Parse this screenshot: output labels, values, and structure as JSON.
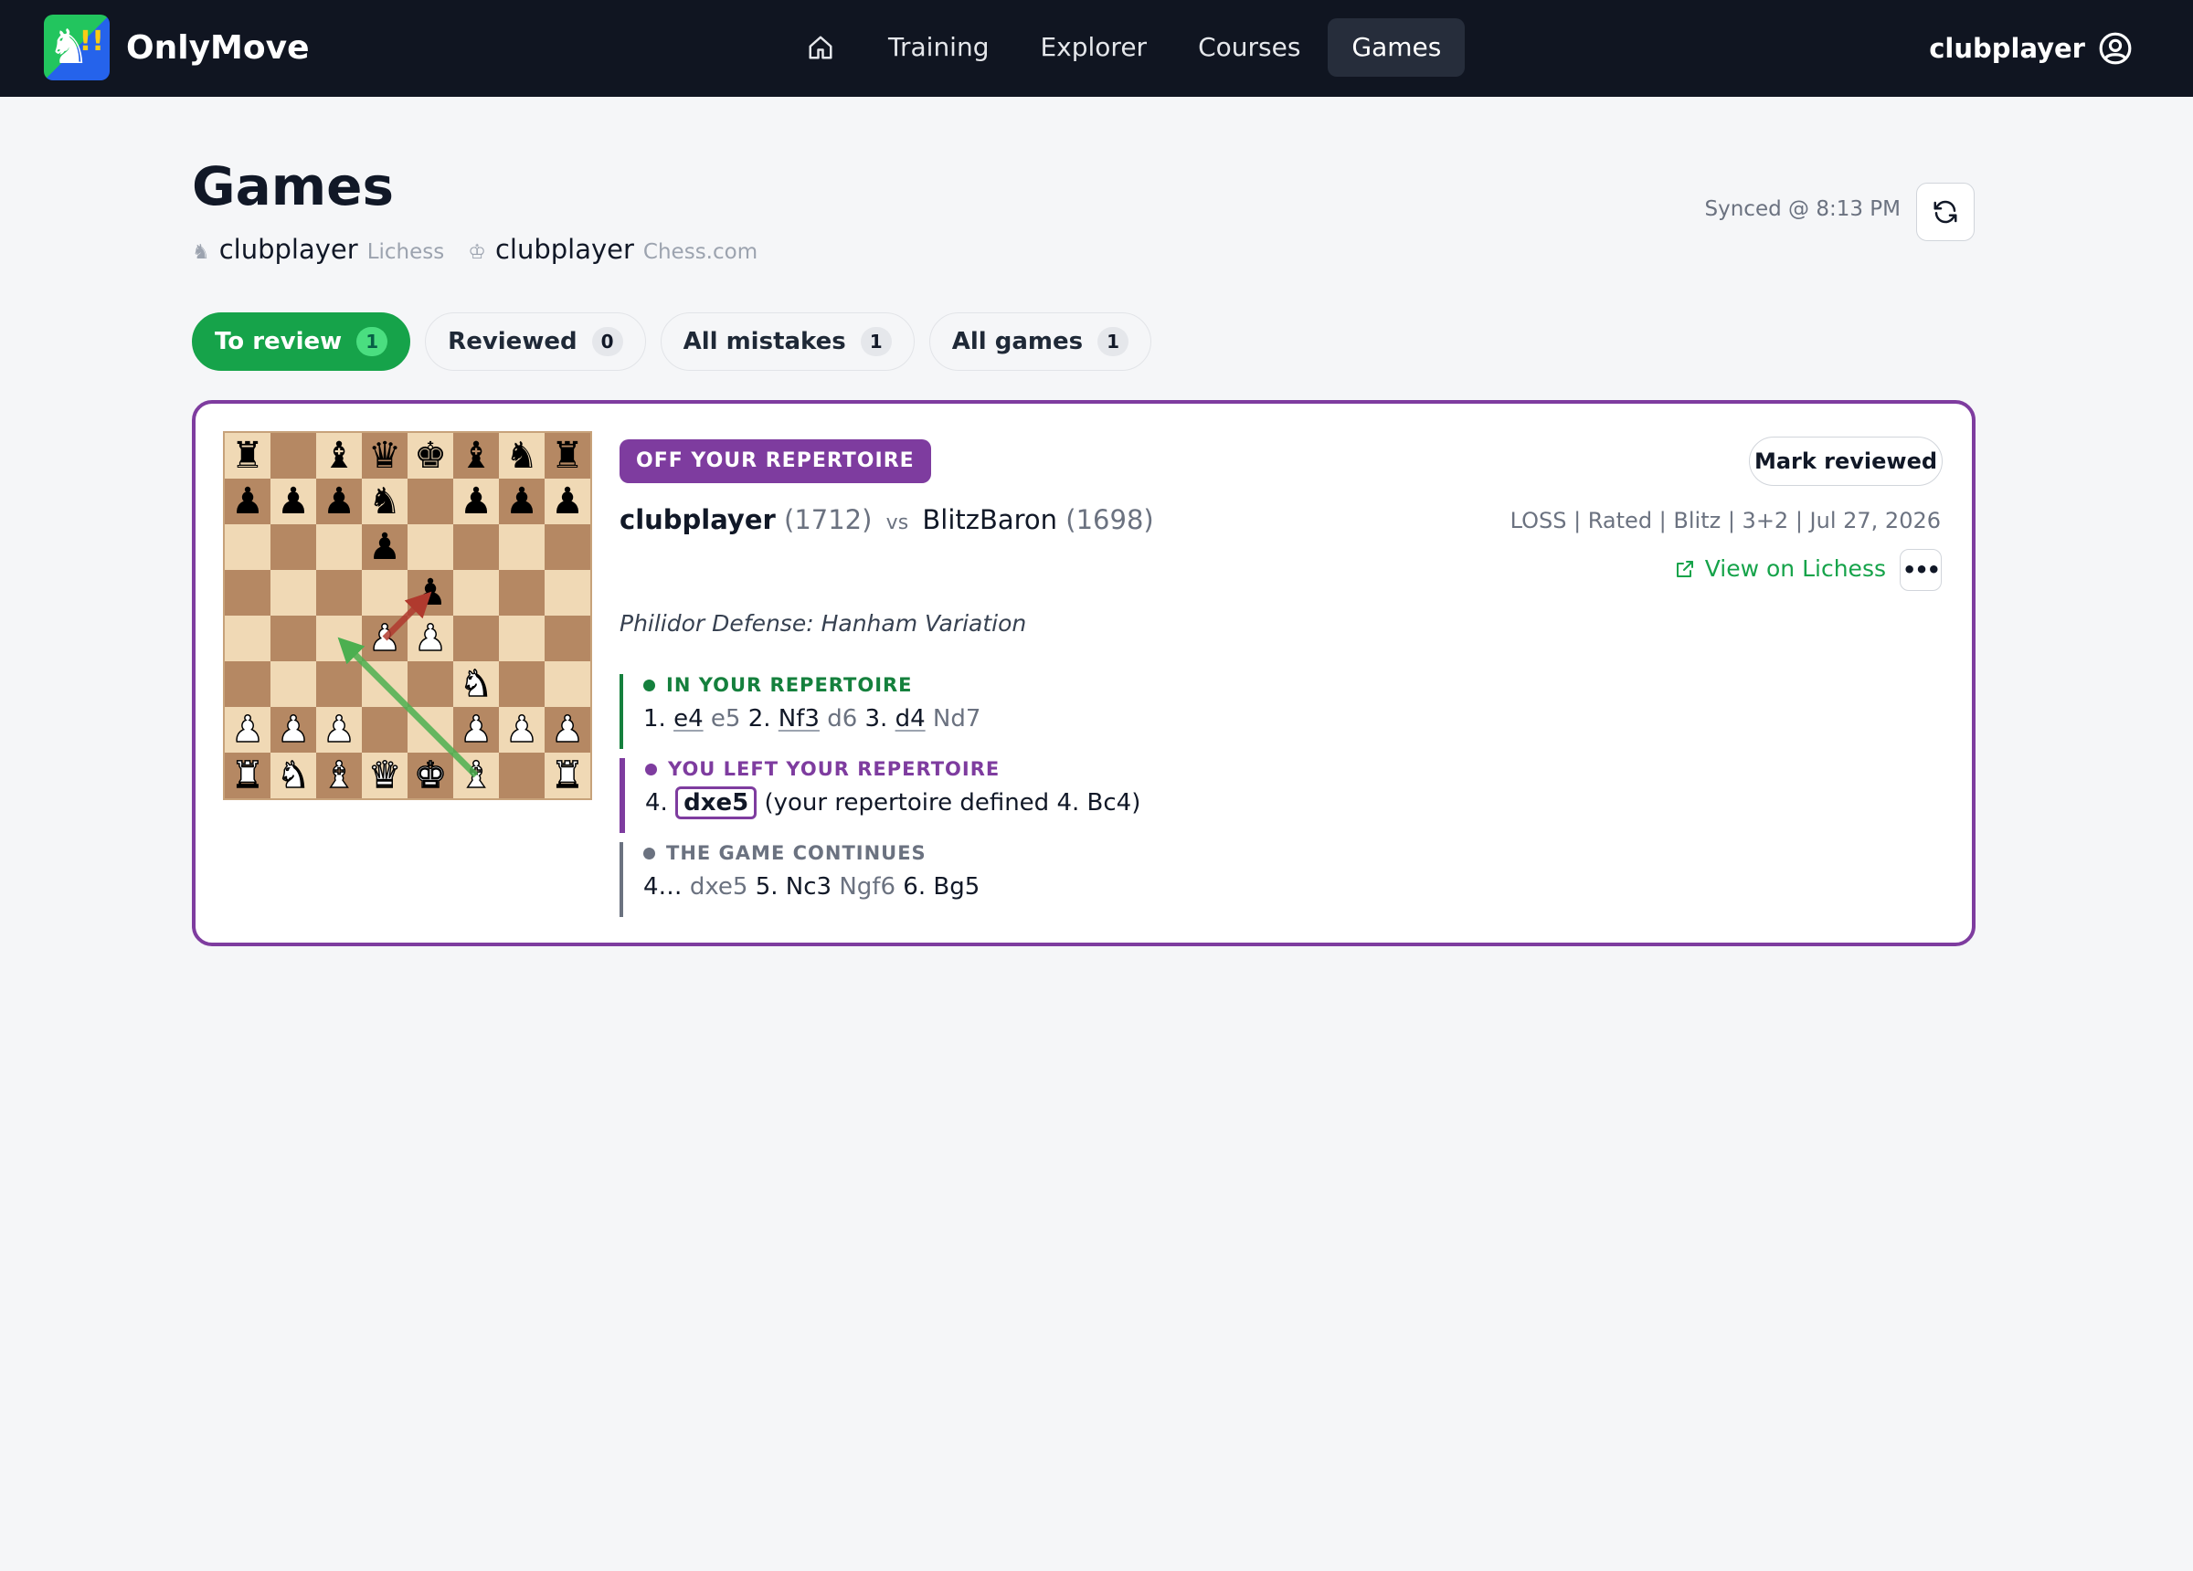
{
  "app": {
    "name": "OnlyMove",
    "logo_mark": "!!",
    "logo_icon": "knight-icon"
  },
  "nav": {
    "home_icon": "home-icon",
    "items": [
      {
        "label": "Training",
        "active": false
      },
      {
        "label": "Explorer",
        "active": false
      },
      {
        "label": "Courses",
        "active": false
      },
      {
        "label": "Games",
        "active": true
      }
    ]
  },
  "user": {
    "name": "clubplayer",
    "icon": "user-circle-icon"
  },
  "page": {
    "title": "Games",
    "accounts": [
      {
        "icon": "pawn-icon",
        "name": "clubplayer",
        "source": "Lichess"
      },
      {
        "icon": "king-icon",
        "name": "clubplayer",
        "source": "Chess.com"
      }
    ],
    "sync_status": "Synced @ 8:13 PM",
    "sync_icon": "refresh-icon"
  },
  "tabs": [
    {
      "label": "To review",
      "count": "1",
      "active": true
    },
    {
      "label": "Reviewed",
      "count": "0",
      "active": false
    },
    {
      "label": "All mistakes",
      "count": "1",
      "active": false
    },
    {
      "label": "All games",
      "count": "1",
      "active": false
    }
  ],
  "game": {
    "badge": "OFF YOUR REPERTOIRE",
    "mark_reviewed_label": "Mark reviewed",
    "white_player": "clubplayer",
    "white_rating": "(1712)",
    "vs": "vs",
    "black_player": "BlitzBaron",
    "black_rating": "(1698)",
    "meta": "LOSS | Rated | Blitz | 3+2 | Jul 27, 2026",
    "view_link_label": "View on Lichess",
    "view_link_icon": "external-link-icon",
    "more_label": "•••",
    "opening": "Philidor Defense: Hanham Variation",
    "sections": {
      "in_repertoire": {
        "heading": "IN YOUR REPERTOIRE",
        "moves": [
          {
            "text": "1.",
            "kind": "num"
          },
          {
            "text": "e4",
            "kind": "mine"
          },
          {
            "text": "e5",
            "kind": "opp"
          },
          {
            "text": "2.",
            "kind": "num"
          },
          {
            "text": "Nf3",
            "kind": "mine"
          },
          {
            "text": "d6",
            "kind": "opp"
          },
          {
            "text": "3.",
            "kind": "num"
          },
          {
            "text": "d4",
            "kind": "mine"
          },
          {
            "text": "Nd7",
            "kind": "opp"
          }
        ]
      },
      "left_repertoire": {
        "heading": "YOU LEFT YOUR REPERTOIRE",
        "move_number": "4.",
        "played_move": "dxe5",
        "note": "(your repertoire defined 4. Bc4)"
      },
      "continues": {
        "heading": "THE GAME CONTINUES",
        "moves": [
          {
            "text": "4…",
            "kind": "num"
          },
          {
            "text": "dxe5",
            "kind": "opp"
          },
          {
            "text": "5.",
            "kind": "num"
          },
          {
            "text": "Nc3",
            "kind": "plain"
          },
          {
            "text": "Ngf6",
            "kind": "opp"
          },
          {
            "text": "6.",
            "kind": "num"
          },
          {
            "text": "Bg5",
            "kind": "plain"
          }
        ]
      }
    },
    "board": {
      "orientation": "white",
      "colors": {
        "light": "#f0d9b5",
        "dark": "#b58863",
        "good_arrow": "#4caf50",
        "bad_arrow": "#b03a2e"
      },
      "ranks": [
        [
          "r",
          "",
          "b",
          "q",
          "k",
          "b",
          "n",
          "r"
        ],
        [
          "p",
          "p",
          "p",
          "n",
          "",
          "p",
          "p",
          "p"
        ],
        [
          "",
          "",
          "",
          "p",
          "",
          "",
          "",
          ""
        ],
        [
          "",
          "",
          "",
          "",
          "p",
          "",
          "",
          ""
        ],
        [
          "",
          "",
          "",
          "P",
          "P",
          "",
          "",
          ""
        ],
        [
          "",
          "",
          "",
          "",
          "",
          "N",
          "",
          ""
        ],
        [
          "P",
          "P",
          "P",
          "",
          "",
          "P",
          "P",
          "P"
        ],
        [
          "R",
          "N",
          "B",
          "Q",
          "K",
          "B",
          "",
          "R"
        ]
      ],
      "arrows": [
        {
          "from": "f1",
          "to": "c4",
          "kind": "good"
        },
        {
          "from": "d4",
          "to": "e5",
          "kind": "bad"
        }
      ]
    }
  },
  "colors": {
    "accent_purple": "#7e3c9f",
    "accent_green": "#16a34a",
    "topbar": "#101521"
  }
}
